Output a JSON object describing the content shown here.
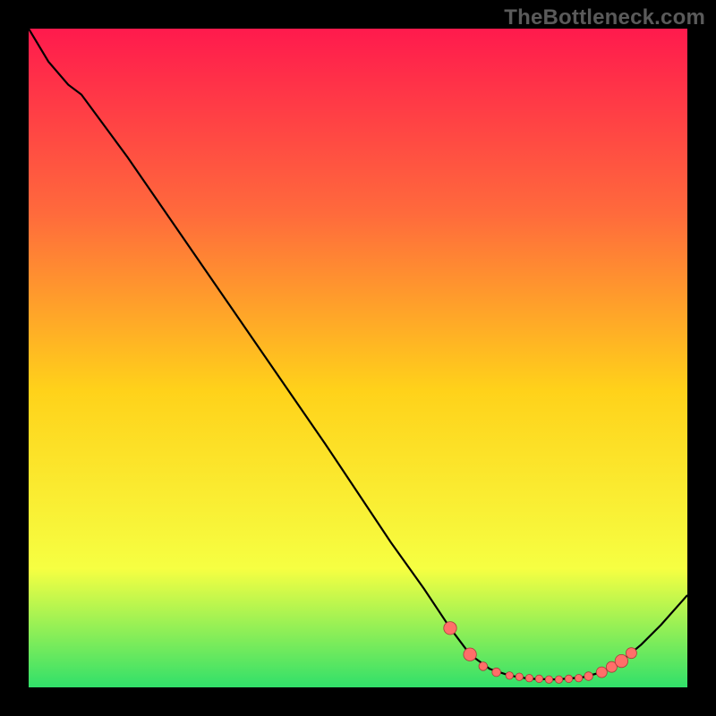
{
  "watermark": "TheBottleneck.com",
  "colors": {
    "frame": "#000000",
    "watermark": "#5a5a5a",
    "grad_top": "#ff1a4d",
    "grad_upper": "#ff6a3c",
    "grad_mid": "#ffd21a",
    "grad_lower": "#f6ff42",
    "grad_bottom": "#31e06a",
    "curve": "#000000",
    "marker_fill": "#ff6f69",
    "marker_stroke": "#a83b3b"
  },
  "chart_data": {
    "type": "line",
    "title": "",
    "xlabel": "",
    "ylabel": "",
    "xlim": [
      0,
      100
    ],
    "ylim": [
      0,
      100
    ],
    "curve": [
      {
        "x": 0,
        "y": 100
      },
      {
        "x": 3,
        "y": 95
      },
      {
        "x": 6,
        "y": 91.5
      },
      {
        "x": 8,
        "y": 90
      },
      {
        "x": 15,
        "y": 80.5
      },
      {
        "x": 25,
        "y": 66
      },
      {
        "x": 35,
        "y": 51.5
      },
      {
        "x": 45,
        "y": 37
      },
      {
        "x": 55,
        "y": 22
      },
      {
        "x": 60,
        "y": 15
      },
      {
        "x": 64,
        "y": 9
      },
      {
        "x": 67,
        "y": 5
      },
      {
        "x": 70,
        "y": 2.8
      },
      {
        "x": 73,
        "y": 1.8
      },
      {
        "x": 76,
        "y": 1.3
      },
      {
        "x": 80,
        "y": 1.2
      },
      {
        "x": 84,
        "y": 1.5
      },
      {
        "x": 87,
        "y": 2.3
      },
      {
        "x": 90,
        "y": 4.0
      },
      {
        "x": 93,
        "y": 6.5
      },
      {
        "x": 96,
        "y": 9.5
      },
      {
        "x": 100,
        "y": 14
      }
    ],
    "markers": [
      {
        "x": 64,
        "y": 9,
        "r": 1.2
      },
      {
        "x": 67,
        "y": 5,
        "r": 1.2
      },
      {
        "x": 69,
        "y": 3.2,
        "r": 0.8
      },
      {
        "x": 71,
        "y": 2.3,
        "r": 0.8
      },
      {
        "x": 73,
        "y": 1.8,
        "r": 0.7
      },
      {
        "x": 74.5,
        "y": 1.6,
        "r": 0.7
      },
      {
        "x": 76,
        "y": 1.4,
        "r": 0.7
      },
      {
        "x": 77.5,
        "y": 1.3,
        "r": 0.7
      },
      {
        "x": 79,
        "y": 1.2,
        "r": 0.7
      },
      {
        "x": 80.5,
        "y": 1.2,
        "r": 0.7
      },
      {
        "x": 82,
        "y": 1.3,
        "r": 0.7
      },
      {
        "x": 83.5,
        "y": 1.4,
        "r": 0.7
      },
      {
        "x": 85,
        "y": 1.7,
        "r": 0.8
      },
      {
        "x": 87,
        "y": 2.3,
        "r": 1.0
      },
      {
        "x": 88.5,
        "y": 3.1,
        "r": 1.0
      },
      {
        "x": 90,
        "y": 4.0,
        "r": 1.2
      },
      {
        "x": 91.5,
        "y": 5.2,
        "r": 1.0
      }
    ]
  }
}
